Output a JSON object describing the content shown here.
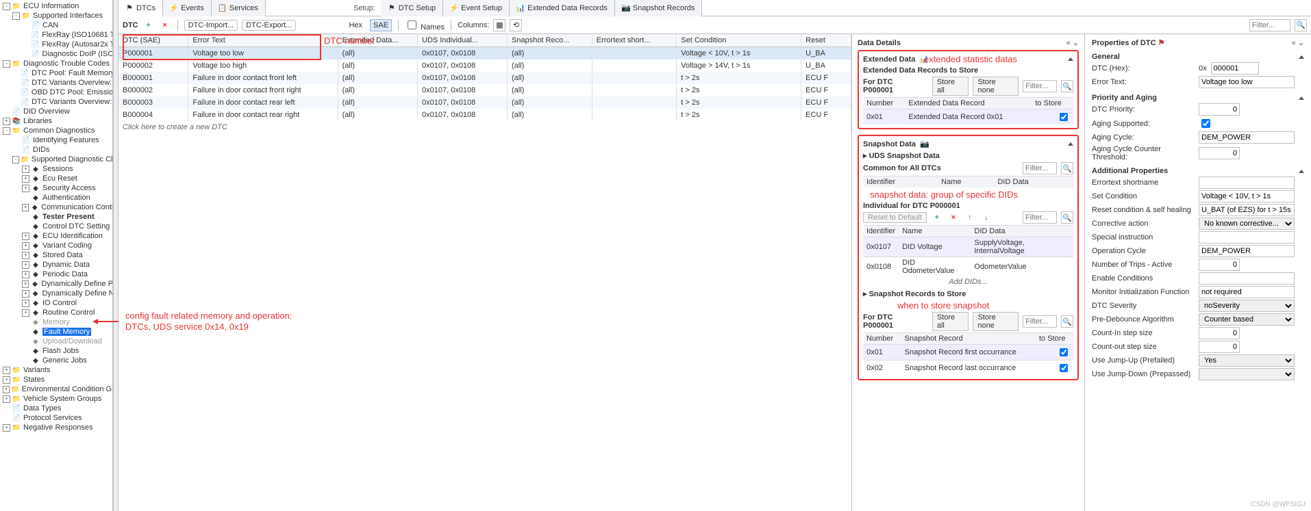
{
  "tree": [
    {
      "d": 0,
      "tw": "-",
      "ico": "📁",
      "label": "ECU Information"
    },
    {
      "d": 1,
      "tw": "-",
      "ico": "📁",
      "label": "Supported Interfaces"
    },
    {
      "d": 2,
      "tw": "",
      "ico": "📄",
      "label": "CAN"
    },
    {
      "d": 2,
      "tw": "",
      "ico": "📄",
      "label": "FlexRay (ISO10681 T"
    },
    {
      "d": 2,
      "tw": "",
      "ico": "📄",
      "label": "FlexRay (Autosar2x T"
    },
    {
      "d": 2,
      "tw": "",
      "ico": "📄",
      "label": "Diagnostic DoIP (ISO"
    },
    {
      "d": 0,
      "tw": "-",
      "ico": "📁",
      "label": "Diagnostic Trouble Codes"
    },
    {
      "d": 1,
      "tw": "",
      "ico": "📄",
      "label": "DTC Pool: Fault Memory ("
    },
    {
      "d": 1,
      "tw": "",
      "ico": "📄",
      "label": "DTC Variants Overview: F"
    },
    {
      "d": 1,
      "tw": "",
      "ico": "📄",
      "label": "OBD DTC Pool: Emission-"
    },
    {
      "d": 1,
      "tw": "",
      "ico": "📄",
      "label": "DTC Variants Overview: E"
    },
    {
      "d": 0,
      "tw": "",
      "ico": "📄",
      "label": "DID Overview"
    },
    {
      "d": 0,
      "tw": "+",
      "ico": "📚",
      "label": "Libraries"
    },
    {
      "d": 0,
      "tw": "-",
      "ico": "📁",
      "label": "Common Diagnostics"
    },
    {
      "d": 1,
      "tw": "",
      "ico": "📄",
      "label": "Identifying Features"
    },
    {
      "d": 1,
      "tw": "",
      "ico": "📄",
      "label": "DIDs"
    },
    {
      "d": 1,
      "tw": "-",
      "ico": "📁",
      "label": "Supported Diagnostic Clas"
    },
    {
      "d": 2,
      "tw": "+",
      "ico": "◆",
      "label": "Sessions"
    },
    {
      "d": 2,
      "tw": "+",
      "ico": "◆",
      "label": "Ecu Reset"
    },
    {
      "d": 2,
      "tw": "+",
      "ico": "◆",
      "label": "Security Access"
    },
    {
      "d": 2,
      "tw": "",
      "ico": "◆",
      "label": "Authentication"
    },
    {
      "d": 2,
      "tw": "+",
      "ico": "◆",
      "label": "Communication Contro"
    },
    {
      "d": 2,
      "tw": "",
      "ico": "◆",
      "label": "Tester Present",
      "bold": true
    },
    {
      "d": 2,
      "tw": "",
      "ico": "◆",
      "label": "Control DTC Setting"
    },
    {
      "d": 2,
      "tw": "+",
      "ico": "◆",
      "label": "ECU Identification"
    },
    {
      "d": 2,
      "tw": "+",
      "ico": "◆",
      "label": "Variant Coding"
    },
    {
      "d": 2,
      "tw": "+",
      "ico": "◆",
      "label": "Stored Data"
    },
    {
      "d": 2,
      "tw": "+",
      "ico": "◆",
      "label": "Dynamic Data"
    },
    {
      "d": 2,
      "tw": "+",
      "ico": "◆",
      "label": "Periodic Data"
    },
    {
      "d": 2,
      "tw": "+",
      "ico": "◆",
      "label": "Dynamically Define Pe"
    },
    {
      "d": 2,
      "tw": "+",
      "ico": "◆",
      "label": "Dynamically Define N"
    },
    {
      "d": 2,
      "tw": "+",
      "ico": "◆",
      "label": "IO Control"
    },
    {
      "d": 2,
      "tw": "+",
      "ico": "◆",
      "label": "Routine Control"
    },
    {
      "d": 2,
      "tw": "",
      "ico": "◆",
      "label": "Memory",
      "dim": true
    },
    {
      "d": 2,
      "tw": "",
      "ico": "◆",
      "label": "Fault Memory",
      "selected": true
    },
    {
      "d": 2,
      "tw": "",
      "ico": "◆",
      "label": "Upload/Download",
      "dim": true
    },
    {
      "d": 2,
      "tw": "",
      "ico": "◆",
      "label": "Flash Jobs"
    },
    {
      "d": 2,
      "tw": "",
      "ico": "◆",
      "label": "Generic Jobs"
    },
    {
      "d": 0,
      "tw": "+",
      "ico": "📁",
      "label": "Variants"
    },
    {
      "d": 0,
      "tw": "+",
      "ico": "📁",
      "label": "States"
    },
    {
      "d": 0,
      "tw": "+",
      "ico": "📁",
      "label": "Environmental Condition Grou"
    },
    {
      "d": 0,
      "tw": "+",
      "ico": "📁",
      "label": "Vehicle System Groups"
    },
    {
      "d": 0,
      "tw": "",
      "ico": "📄",
      "label": "Data Types"
    },
    {
      "d": 0,
      "tw": "",
      "ico": "📄",
      "label": "Protocol Services"
    },
    {
      "d": 0,
      "tw": "+",
      "ico": "📁",
      "label": "Negative Responses"
    }
  ],
  "tabs": {
    "main": [
      {
        "id": "dtcs",
        "label": "DTCs",
        "icon": "⚑",
        "active": true
      },
      {
        "id": "events",
        "label": "Events",
        "icon": "⚡"
      },
      {
        "id": "services",
        "label": "Services",
        "icon": "📋"
      }
    ],
    "setup_label": "Setup:",
    "setup": [
      {
        "id": "dtc-setup",
        "label": "DTC Setup",
        "icon": "⚑"
      },
      {
        "id": "event-setup",
        "label": "Event Setup",
        "icon": "⚡"
      },
      {
        "id": "ext-data",
        "label": "Extended Data Records",
        "icon": "📊"
      },
      {
        "id": "snap",
        "label": "Snapshot Records",
        "icon": "📷"
      }
    ]
  },
  "toolbar": {
    "dtc_label": "DTC",
    "add": "+",
    "del": "×",
    "import": "DTC-Import...",
    "export": "DTC-Export...",
    "hex": "Hex",
    "sae": "SAE",
    "names": "Names",
    "columns": "Columns:",
    "filter_placeholder": "Filter..."
  },
  "grid": {
    "headers": [
      "DTC (SAE)",
      "Error Text",
      "Extended Data...",
      "UDS Individual...",
      "Snapshot Reco...",
      "Errortext short...",
      "Set Condition",
      "Reset"
    ],
    "rows": [
      {
        "sae": "P000001",
        "err": "Voltage too low",
        "ext": "(all)",
        "uds": "0x0107, 0x0108",
        "snap": "(all)",
        "short": "",
        "set": "Voltage < 10V, t > 1s",
        "reset": "U_BA",
        "sel": true
      },
      {
        "sae": "P000002",
        "err": "Voltage too high",
        "ext": "(all)",
        "uds": "0x0107, 0x0108",
        "snap": "(all)",
        "short": "",
        "set": "Voltage > 14V, t > 1s",
        "reset": "U_BA"
      },
      {
        "sae": "B000001",
        "err": "Failure in door contact front left",
        "ext": "(all)",
        "uds": "0x0107, 0x0108",
        "snap": "(all)",
        "short": "",
        "set": "t > 2s",
        "reset": "ECU F"
      },
      {
        "sae": "B000002",
        "err": "Failure in door contact front right",
        "ext": "(all)",
        "uds": "0x0107, 0x0108",
        "snap": "(all)",
        "short": "",
        "set": "t > 2s",
        "reset": "ECU F"
      },
      {
        "sae": "B000003",
        "err": "Failure in door contact rear left",
        "ext": "(all)",
        "uds": "0x0107, 0x0108",
        "snap": "(all)",
        "short": "",
        "set": "t > 2s",
        "reset": "ECU F"
      },
      {
        "sae": "B000004",
        "err": "Failure in door contact rear right",
        "ext": "(all)",
        "uds": "0x0107, 0x0108",
        "snap": "(all)",
        "short": "",
        "set": "t > 2s",
        "reset": "ECU F"
      }
    ],
    "newrow": "Click here to create a new DTC"
  },
  "details": {
    "header": "Data Details",
    "ext": {
      "title": "Extended Data",
      "sub": "Extended Data Records to Store",
      "for": "For DTC P000001",
      "store_all": "Store all",
      "store_none": "Store none",
      "filter": "Filter...",
      "th": [
        "Number",
        "Extended Data Record",
        "to Store"
      ],
      "rows": [
        {
          "num": "0x01",
          "name": "Extended Data Record 0x01",
          "store": true
        }
      ]
    },
    "snap": {
      "title": "Snapshot Data",
      "uds_head": "UDS Snapshot Data",
      "common": "Common for All DTCs",
      "filter": "Filter...",
      "th_common": [
        "Identifier",
        "Name",
        "DID Data"
      ],
      "individual": "Individual for DTC P000001",
      "reset": "Reset to Default",
      "th_indiv": [
        "Identifier",
        "Name",
        "DID Data"
      ],
      "indiv_rows": [
        {
          "id": "0x0107",
          "name": "DID Voltage",
          "data": "SupplyVoltage, InternalVoltage"
        },
        {
          "id": "0x0108",
          "name": "DID OdometerValue",
          "data": "OdometerValue"
        }
      ],
      "add_dids": "Add DIDs...",
      "records_head": "Snapshot Records to Store",
      "for": "For DTC P000001",
      "store_all": "Store all",
      "store_none": "Store none",
      "th_rec": [
        "Number",
        "Snapshot Record",
        "to Store"
      ],
      "rec_rows": [
        {
          "num": "0x01",
          "name": "Snapshot Record first occurrance",
          "store": true
        },
        {
          "num": "0x02",
          "name": "Snapshot Record last occurrance",
          "store": true
        }
      ]
    }
  },
  "props": {
    "header": "Properties of DTC",
    "general": "General",
    "dtc_hex_label": "DTC (Hex):",
    "dtc_hex_prefix": "0x",
    "dtc_hex_val": "000001",
    "err_label": "Error Text:",
    "err_val": "Voltage too low",
    "pri_aging": "Priority and Aging",
    "dtc_priority": "DTC Priority:",
    "dtc_priority_val": "0",
    "aging_supported": "Aging Supported:",
    "aging_supported_val": true,
    "aging_cycle": "Aging Cycle:",
    "aging_cycle_val": "DEM_POWER",
    "aging_thresh": "Aging Cycle Counter Threshold:",
    "aging_thresh_val": "0",
    "addl": "Additional Properties",
    "rows": [
      {
        "l": "Errortext shortname",
        "v": "",
        "t": "text"
      },
      {
        "l": "Set Condition",
        "v": "Voltage < 10V, t > 1s",
        "t": "text"
      },
      {
        "l": "Reset condition & self healing",
        "v": "U_BAT (of EZS) for t > 15s;",
        "t": "text"
      },
      {
        "l": "Corrective action",
        "v": "No known corrective...",
        "t": "select"
      },
      {
        "l": "Special instruction",
        "v": "",
        "t": "text"
      },
      {
        "l": "Operation Cycle",
        "v": "DEM_POWER",
        "t": "text"
      },
      {
        "l": "Number of Trips - Active",
        "v": "0",
        "t": "num"
      },
      {
        "l": "Enable Conditions",
        "v": "",
        "t": "text"
      },
      {
        "l": "Monitor Initialization Function",
        "v": "not required",
        "t": "text"
      },
      {
        "l": "DTC Severity",
        "v": "noSeverity",
        "t": "select"
      },
      {
        "l": "Pre-Debounce Algorithm",
        "v": "Counter based",
        "t": "select"
      },
      {
        "l": "Count-In step size",
        "v": "0",
        "t": "num"
      },
      {
        "l": "Count-out step size",
        "v": "0",
        "t": "num"
      },
      {
        "l": "Use Jump-Up (Prefailed)",
        "v": "Yes",
        "t": "select"
      },
      {
        "l": "Use Jump-Down (Prepassed)",
        "v": "",
        "t": "select"
      }
    ]
  },
  "annot": {
    "a1": "DTC number",
    "a2": "extended statistic datas",
    "a3": "snapshot data: group of specific DIDs",
    "a4": "when to store snapshot",
    "a5": "config fault related memory and operation:",
    "a5b": "DTCs, UDS service 0x14, 0x19"
  },
  "watermark": "CSDN @WPSIGJ"
}
